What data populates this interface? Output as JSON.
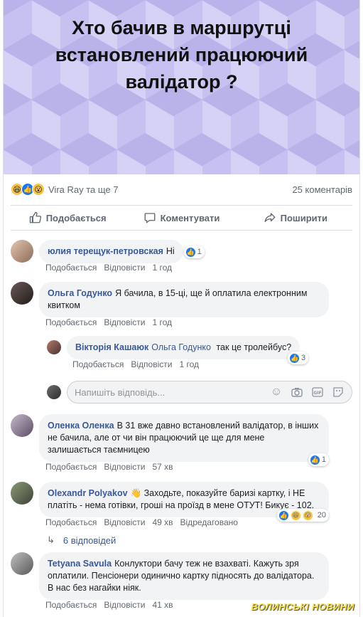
{
  "hero": {
    "title": "Хто бачив в маршрутці\nвстановлений працюючий\nвалідатор ?"
  },
  "reactions": {
    "names": "Vira Ray та ще 7",
    "comments_count": "25 коментарів"
  },
  "actions": {
    "like": "Подобається",
    "comment": "Коментувати",
    "share": "Поширити"
  },
  "comments": [
    {
      "author": "юлия терещук-петровская",
      "text": "Ні",
      "like_label": "Подобається",
      "reply_label": "Відповісти",
      "time": "1 год",
      "reactions_count": "1"
    },
    {
      "author": "Ольга Годунко",
      "text": "Я бачила, в 15-ці, ще й оплатила електронним квитком",
      "like_label": "Подобається",
      "reply_label": "Відповісти",
      "time": "1 год"
    },
    {
      "author": "Оленка Оленка",
      "text": "В 31 вже давно встановлений валідатор, в інших не бачила, але от чи він працюючий це ще для мене залишається таємницею",
      "like_label": "Подобається",
      "reply_label": "Відповісти",
      "time": "57 хв",
      "reactions_count": "1"
    },
    {
      "author": "Olexandr Polyakov",
      "text": "👋 Заходьте, показуйте баризі картку, і НЕ платіть - нема готівки, гроші на проїзд в мене ОТУТ! Бикує - 102.",
      "like_label": "Подобається",
      "reply_label": "Відповісти",
      "time": "49 хв",
      "edited": "Відредаговано",
      "reactions_count": "20"
    },
    {
      "author": "Tetyana Savula",
      "text": "Конлуктори бачу теж не взахваті. Кажуть зря оплатили. Пенсіонери одинично картку підносять до валідатора. В нас без нагайки ніяк.",
      "like_label": "Подобається",
      "reply_label": "Відповісти",
      "time": "41 хв"
    }
  ],
  "reply": {
    "author": "Вікторія Кашаюк",
    "mention": "Ольга Годунко",
    "text": "так це тролейбус?",
    "like_label": "Подобається",
    "reply_label": "Відповісти",
    "time": "1 год",
    "reactions_count": "3"
  },
  "reply_input": {
    "placeholder": "Напишіть відповідь..."
  },
  "replies_link": {
    "label": "6 відповідей"
  },
  "watermark": {
    "text": "ВОЛИНСЬКІ НОВИНИ"
  },
  "colors": {
    "link": "#385898",
    "bubble": "#f2f3f5",
    "like_blue": "#1877f2",
    "hero_bg": "#c6c1f0",
    "watermark": "#f6e24a"
  }
}
